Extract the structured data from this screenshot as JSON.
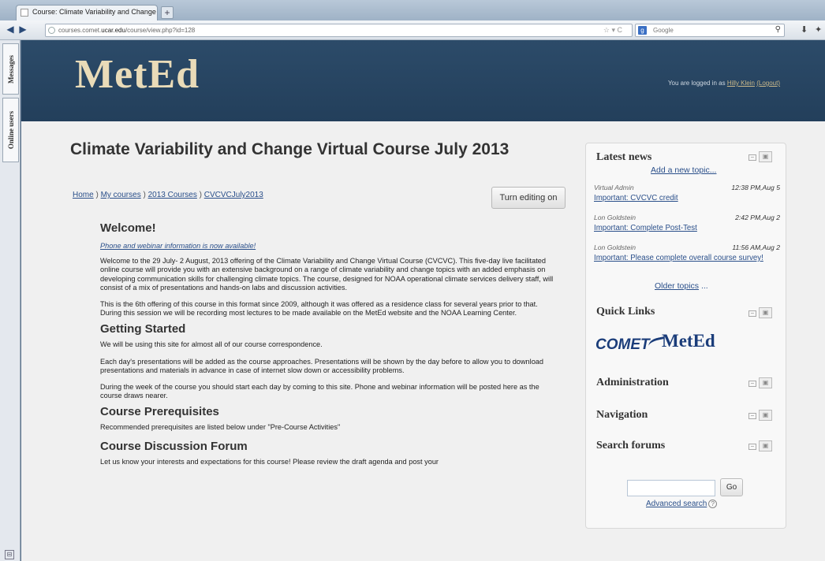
{
  "browser": {
    "tab_title": "Course: Climate Variability and Change ...",
    "new_tab": "+",
    "url_prefix": "courses.comet.",
    "url_host": "ucar.edu",
    "url_path": "/course/view.php?id=128",
    "search_engine": "Google"
  },
  "sidebar": {
    "messages_label": "Messages",
    "online_users_label": "Online users"
  },
  "header": {
    "logo": "MetEd",
    "login_text": "You are logged in as",
    "login_user": "Hilly Klein",
    "logout": "(Logout)"
  },
  "course": {
    "title": "Climate Variability and Change Virtual Course July 2013",
    "breadcrumb": [
      "Home",
      "My courses",
      "2013 Courses",
      "CVCVCJuly2013"
    ],
    "breadcrumb_sep": " ) ",
    "edit_button": "Turn editing on"
  },
  "content": {
    "welcome_heading": "Welcome!",
    "phone_link": "Phone and webinar information is now available!",
    "welcome_p1": "Welcome to the 29 July- 2 August, 2013 offering of the Climate Variability and Change Virtual Course (CVCVC). This five-day live facilitated online course will provide you with an extensive background on a range of climate variability and change topics with an added emphasis on developing communication skills for challenging climate topics. The course, designed for NOAA operational climate services delivery staff, will consist of a mix of presentations and hands-on labs and discussion activities.",
    "welcome_p2": "This is the 6th offering of this course in this format since 2009, although it was offered as a residence class for several years prior to that. During this session we will be recording most lectures to be made available on the MetEd website and the NOAA Learning Center.",
    "getting_started_heading": "Getting Started",
    "gs_p1": "We will be using this site for almost all of our course correspondence.",
    "gs_p2": "Each day's presentations will be added as the course approaches. Presentations will be shown by the day before to allow you to download presentations and materials in advance in case of internet slow down or accessibility problems.",
    "gs_p3": "During the week of the course you should start each day by coming to this site. Phone and webinar information will be posted here as the course draws nearer.",
    "prereq_heading": "Course Prerequisites",
    "prereq_p1": "Recommended prerequisites are listed below under \"Pre-Course Activities\"",
    "forum_heading": "Course Discussion Forum",
    "forum_p1": "Let us know your interests and expectations for this course! Please review the draft agenda and post your"
  },
  "blocks": {
    "latest_news_title": "Latest news",
    "add_topic": "Add a new topic...",
    "news": [
      {
        "author": "Virtual Admin",
        "when": "12:38 PM,Aug 5",
        "subject": "Important: CVCVC credit"
      },
      {
        "author": "Lon Goldstein",
        "when": "2:42 PM,Aug 2",
        "subject": "Important: Complete Post-Test"
      },
      {
        "author": "Lon Goldstein",
        "when": "11:56 AM,Aug 2",
        "subject": "Important: Please complete overall course survey!"
      }
    ],
    "older_topics": "Older topics",
    "older_suffix": " ...",
    "quick_links_title": "Quick Links",
    "comet_logo": "COMET",
    "meted_logo": "MetEd",
    "administration_title": "Administration",
    "navigation_title": "Navigation",
    "search_forums_title": "Search forums",
    "go_button": "Go",
    "advanced_search": "Advanced search"
  },
  "icons": {
    "block_minimize": "minus-icon",
    "block_dock": "dock-icon",
    "help": "question-icon"
  }
}
